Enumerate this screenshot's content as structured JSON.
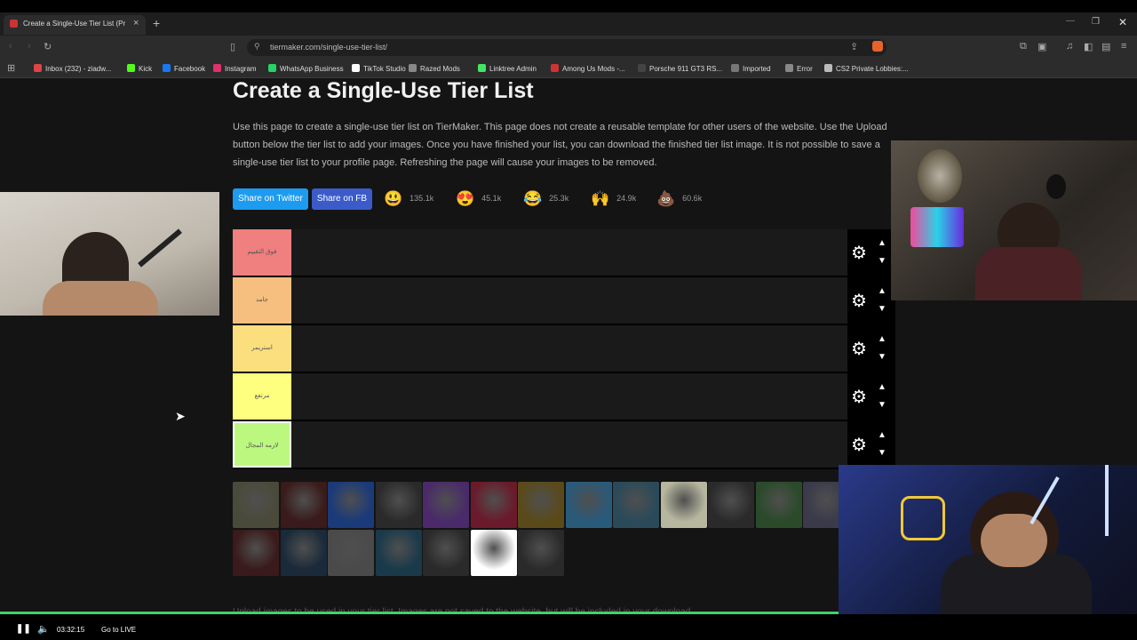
{
  "browser": {
    "tab_title": "Create a Single-Use Tier List (Pr",
    "url": "tiermaker.com/single-use-tier-list/",
    "bookmarks": [
      {
        "label": "Inbox (232) - ziadw...",
        "color": "#d44"
      },
      {
        "label": "Kick",
        "color": "#53fc18"
      },
      {
        "label": "Facebook",
        "color": "#1877f2"
      },
      {
        "label": "Instagram",
        "color": "#e1306c"
      },
      {
        "label": "WhatsApp Business",
        "color": "#25d366"
      },
      {
        "label": "TikTok Studio",
        "color": "#ffffff"
      },
      {
        "label": "Razed Mods",
        "color": "#888"
      },
      {
        "label": "Linktree Admin",
        "color": "#43e660"
      },
      {
        "label": "Among Us Mods -...",
        "color": "#c33"
      },
      {
        "label": "Porsche 911 GT3 RS...",
        "color": "#444"
      },
      {
        "label": "Imported",
        "color": "#777"
      },
      {
        "label": "Error",
        "color": "#888"
      },
      {
        "label": "CS2 Private Lobbies:...",
        "color": "#bbb"
      }
    ]
  },
  "page": {
    "title": "Create a Single-Use Tier List",
    "description": "Use this page to create a single-use tier list on TierMaker. This page does not create a reusable template for other users of the website. Use the Upload button below the tier list to add your images. Once you have finished your list, you can download the finished tier list image. It is not possible to save a single-use tier list to your profile page. Refreshing the page will cause your images to be removed.",
    "share_twitter": "Share on Twitter",
    "share_fb": "Share on FB",
    "reactions": [
      {
        "emoji": "😃",
        "count": "135.1k"
      },
      {
        "emoji": "😍",
        "count": "45.1k"
      },
      {
        "emoji": "😂",
        "count": "25.3k"
      },
      {
        "emoji": "🙌",
        "count": "24.9k"
      },
      {
        "emoji": "💩",
        "count": "60.6k"
      }
    ],
    "tiers": [
      {
        "label": "فوق التقييم",
        "color": "#f07f7f"
      },
      {
        "label": "جامد",
        "color": "#f6bf7f"
      },
      {
        "label": "استريمر",
        "color": "#fbdf7f"
      },
      {
        "label": "مرتفع",
        "color": "#fefe7f"
      },
      {
        "label": "لازمه المجال",
        "color": "#bcf77f"
      }
    ],
    "upload_text": "Upload images to be used in your tier list. Images are not saved to the website, but will be included in your download."
  },
  "thumbnails_row1": [
    "#4a4a3a",
    "#3a1a1a",
    "#1a3a7a",
    "#2a2a2a",
    "#4a2a6a",
    "#6a1a2a",
    "#5a4a1a",
    "#2a5a7a",
    "#2a4a5a",
    "#b7b7a0",
    "#2a2a2a",
    "#2a4a2a",
    "#3a3a4a"
  ],
  "thumbnails_row2": [
    "#3a1a1a",
    "#1a2a3a",
    "#4a4a4a",
    "#1a3a4a",
    "#2a2a2a",
    "#ffffff",
    "#2a2a2a"
  ],
  "player": {
    "time": "03:32:15",
    "live": "Go to LIVE"
  }
}
